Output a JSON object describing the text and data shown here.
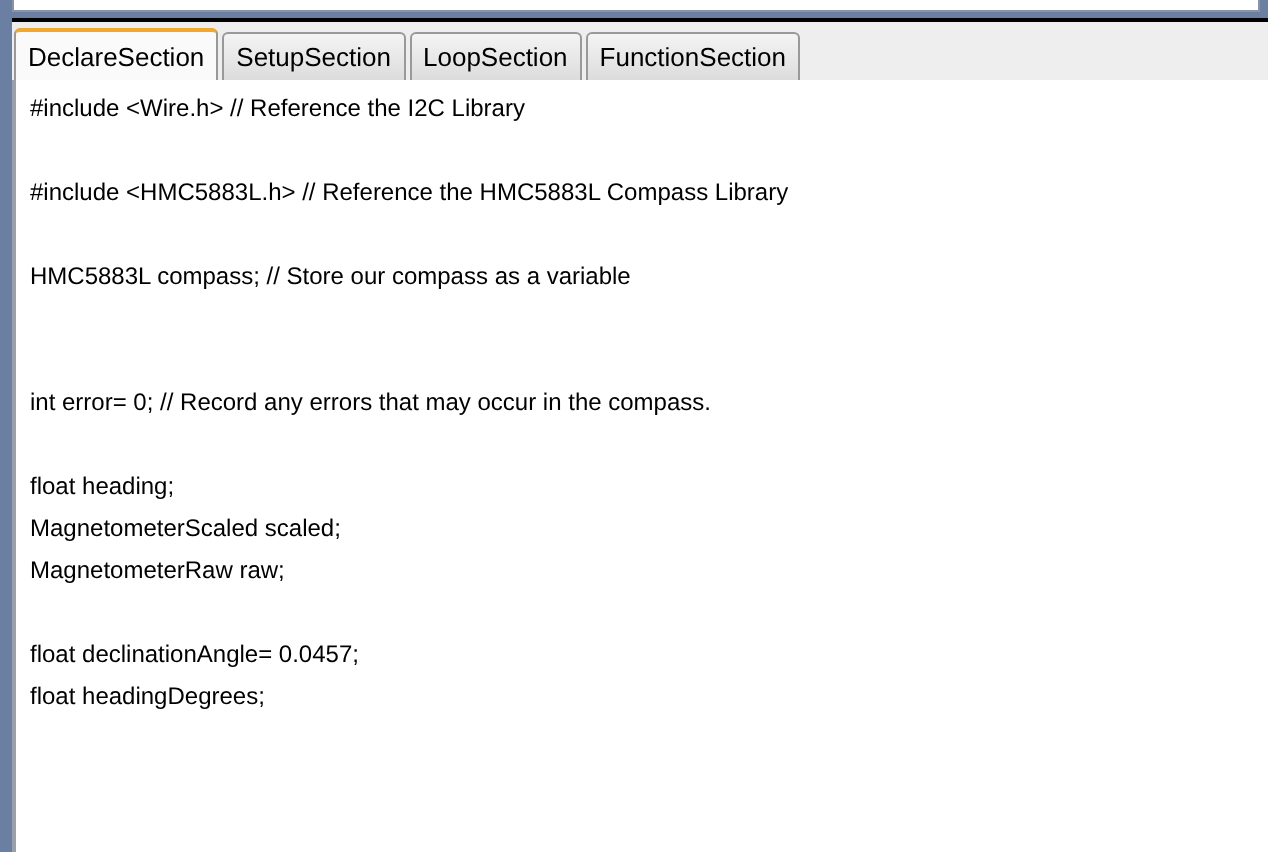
{
  "tabs": [
    {
      "label": "DeclareSection",
      "selected": true
    },
    {
      "label": "SetupSection",
      "selected": false
    },
    {
      "label": "LoopSection",
      "selected": false
    },
    {
      "label": "FunctionSection",
      "selected": false
    }
  ],
  "editor": {
    "lines": [
      {
        "kind": "code",
        "text": "#include <Wire.h> // Reference the I2C Library"
      },
      {
        "kind": "blank"
      },
      {
        "kind": "code",
        "text": "#include <HMC5883L.h> // Reference the HMC5883L Compass Library"
      },
      {
        "kind": "blank"
      },
      {
        "kind": "code",
        "text": "HMC5883L compass; // Store our compass as a variable"
      },
      {
        "kind": "blank"
      },
      {
        "kind": "blank"
      },
      {
        "kind": "code",
        "text": "int error= 0; // Record any errors that may occur in the compass."
      },
      {
        "kind": "blank"
      },
      {
        "kind": "code",
        "text": "float heading;"
      },
      {
        "kind": "code",
        "text": "MagnetometerScaled scaled;"
      },
      {
        "kind": "code",
        "text": "MagnetometerRaw raw;"
      },
      {
        "kind": "blank"
      },
      {
        "kind": "code",
        "text": "float declinationAngle= 0.0457;"
      },
      {
        "kind": "code",
        "text": "float headingDegrees;"
      }
    ]
  }
}
